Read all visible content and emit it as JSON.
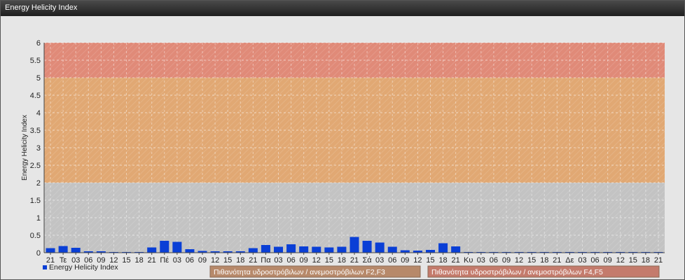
{
  "window": {
    "title": "Energy Helicity Index"
  },
  "chart_data": {
    "type": "bar",
    "ylabel": "Energy Helicity Index",
    "ylim": [
      0,
      6
    ],
    "yticks": [
      0,
      0.5,
      1,
      1.5,
      2,
      2.5,
      3,
      3.5,
      4,
      4.5,
      5,
      5.5,
      6
    ],
    "grid": true,
    "categories": [
      "21",
      "Τε",
      "03",
      "06",
      "09",
      "12",
      "15",
      "18",
      "21",
      "Πέ",
      "03",
      "06",
      "09",
      "12",
      "15",
      "18",
      "21",
      "Πα",
      "03",
      "06",
      "09",
      "12",
      "15",
      "18",
      "21",
      "Σά",
      "03",
      "06",
      "09",
      "12",
      "15",
      "18",
      "21",
      "Κυ",
      "03",
      "06",
      "09",
      "12",
      "15",
      "18",
      "21",
      "Δε",
      "03",
      "06",
      "09",
      "12",
      "15",
      "18",
      "21"
    ],
    "series": [
      {
        "name": "Energy Helicity Index",
        "color": "#0a3fd6",
        "values": [
          0.13,
          0.19,
          0.14,
          0.04,
          0.04,
          0.02,
          0.02,
          0.02,
          0.15,
          0.34,
          0.31,
          0.1,
          0.05,
          0.04,
          0.04,
          0.04,
          0.13,
          0.22,
          0.17,
          0.24,
          0.18,
          0.17,
          0.15,
          0.17,
          0.45,
          0.34,
          0.29,
          0.17,
          0.07,
          0.06,
          0.08,
          0.27,
          0.18,
          0.02,
          0.02,
          0.02,
          0.02,
          0.02,
          0.02,
          0.02,
          0.02,
          0.02,
          0.02,
          0.02,
          0.02,
          0.02,
          0.02,
          0.02,
          0.02
        ]
      }
    ],
    "bands": [
      {
        "from": 0,
        "to": 2,
        "color": "#c3c3c3"
      },
      {
        "from": 2,
        "to": 5,
        "color": "#e1a873",
        "label": "Πιθανότητα υδροστρόβιλων / ανεμοστρόβιλων F2,F3"
      },
      {
        "from": 5,
        "to": 6,
        "color": "#e08a78",
        "label": "Πιθανότητα υδροστρόβιλων / ανεμοστρόβιλων F4,F5"
      }
    ],
    "band_legend_colors": [
      "#b7896a",
      "#c47b6c"
    ]
  }
}
